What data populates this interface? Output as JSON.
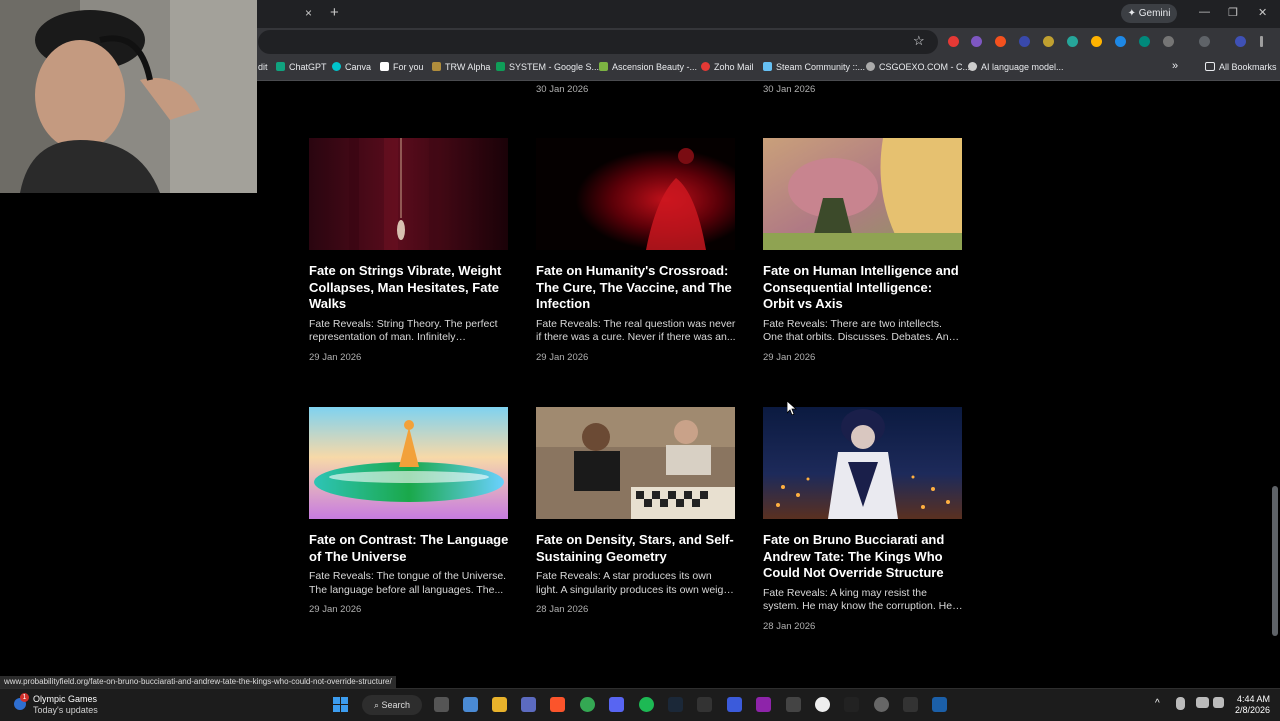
{
  "browser": {
    "tab_close": "×",
    "new_tab": "+",
    "gemini_label": "✦ Gemini",
    "win_min": "—",
    "win_max": "❐",
    "win_close": "✕",
    "star": "☆",
    "bookmarks_more": "»",
    "all_bookmarks": "All Bookmarks",
    "bookmarks": [
      {
        "label": "dit",
        "color": "#444"
      },
      {
        "label": "ChatGPT",
        "color": "#10a37f"
      },
      {
        "label": "Canva",
        "color": "#00c4cc"
      },
      {
        "label": "For you",
        "color": "#000000"
      },
      {
        "label": "TRW Alpha",
        "color": "#b08d3c"
      },
      {
        "label": "SYSTEM - Google S...",
        "color": "#0f9d58"
      },
      {
        "label": "Ascension Beauty -...",
        "color": "#7cb342"
      },
      {
        "label": "Zoho Mail",
        "color": "#e53935"
      },
      {
        "label": "Steam Community ::...",
        "color": "#1b2838"
      },
      {
        "label": "CSGOEXO.COM - C...",
        "color": "#555"
      },
      {
        "label": "AI language model...",
        "color": "#999"
      }
    ]
  },
  "articles": {
    "top_dates": [
      "30 Jan 2026",
      "30 Jan 2026"
    ],
    "cards": [
      {
        "title": "Fate on Strings Vibrate, Weight Collapses, Man Hesitates, Fate Walks",
        "excerpt": "Fate Reveals: String Theory. The perfect representation of man. Infinitely debating....",
        "date": "29 Jan 2026",
        "thumb": "dark red curtain with dangling figure"
      },
      {
        "title": "Fate on Humanity's Crossroad: The Cure, The Vaccine, and The Infection",
        "excerpt": "Fate Reveals: The real question was never if there was a cure. Never if there was an...",
        "date": "29 Jan 2026",
        "thumb": "red lit figure in darkness"
      },
      {
        "title": "Fate on Human Intelligence and Consequential Intelligence: Orbit vs Axis",
        "excerpt": "Fate Reveals: There are two intellects. One that orbits. Discusses. Debates. And one...",
        "date": "29 Jan 2026",
        "thumb": "anime titan with soldier"
      },
      {
        "title": "Fate on Contrast: The Language of The Universe",
        "excerpt": "Fate Reveals: The tongue of the Universe. The language before all languages. The...",
        "date": "29 Jan 2026",
        "thumb": "prismatic rainbow light scene"
      },
      {
        "title": "Fate on Density, Stars, and Self-Sustaining Geometry",
        "excerpt": "Fate Reveals: A star produces its own light. A singularity produces its own weight. For...",
        "date": "28 Jan 2026",
        "thumb": "chess player at tournament"
      },
      {
        "title": "Fate on Bruno Bucciarati and Andrew Tate: The Kings Who Could Not Override Structure",
        "excerpt": "Fate Reveals: A king may resist the system. He may know the corruption. He may figh...",
        "date": "28 Jan 2026",
        "thumb": "anime character over night city"
      }
    ]
  },
  "status_url": "www.probabilityfield.org/fate-on-bruno-bucciarati-and-andrew-tate-the-kings-who-could-not-override-structure/",
  "taskbar": {
    "news_title": "Olympic Games",
    "news_sub": "Today's updates",
    "news_badge": "1",
    "search_label": "Search",
    "time": "4:44 AM",
    "date": "2/8/2026"
  }
}
